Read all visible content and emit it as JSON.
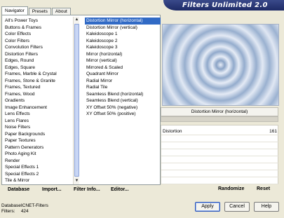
{
  "app": {
    "banner_title": "Filters Unlimited 2.0"
  },
  "tabs": [
    {
      "label": "Navigator",
      "active": true
    },
    {
      "label": "Presets",
      "active": false
    },
    {
      "label": "About",
      "active": false
    }
  ],
  "categories": [
    "All's Power Toys",
    "Buttons & Frames",
    "Color Effects",
    "Color Filters",
    "Convolution Filters",
    "Distortion Filters",
    "Edges, Round",
    "Edges, Square",
    "Frames, Marble & Crystal",
    "Frames, Stone & Granite",
    "Frames, Textured",
    "Frames, Wood",
    "Gradients",
    "Image Enhancement",
    "Lens Effects",
    "Lens Flares",
    "Noise Filters",
    "Paper Backgrounds",
    "Paper Textures",
    "Pattern Generators",
    "Photo Aging Kit",
    "Render",
    "Special Effects 1",
    "Special Effects 2",
    "Tile & Mirror"
  ],
  "filters": [
    "Distortion Mirror (horizontal)",
    "Distortion Mirror (vertical)",
    "Kaleidoscope 1",
    "Kaleidoscope 2",
    "Kaleidoscope 3",
    "Mirror (horizontal)",
    "Mirror (vertical)",
    "Mirrored & Scaled",
    "Quadrant Mirror",
    "Radial Mirror",
    "Radial Tile",
    "Seamless Blend (horizontal)",
    "Seamless Blend (vertical)",
    "XY Offset 50% (negative)",
    "XY Offset 50% (positive)"
  ],
  "selected_filter_index": 0,
  "left_buttons": {
    "database": "Database",
    "import": "Import...",
    "filter_info": "Filter Info...",
    "editor": "Editor..."
  },
  "preview": {
    "filter_title": "Distortion Mirror (horizontal)"
  },
  "controls": [
    {
      "name": "Distortion",
      "value": "161"
    }
  ],
  "right_buttons": {
    "randomize": "Randomize",
    "reset": "Reset"
  },
  "status": {
    "database_label": "Database:",
    "database_value": "ICNET-Filters",
    "filters_label": "Filters:",
    "filters_value": "424"
  },
  "dialog_buttons": {
    "apply": "Apply",
    "cancel": "Cancel",
    "help": "Help"
  }
}
